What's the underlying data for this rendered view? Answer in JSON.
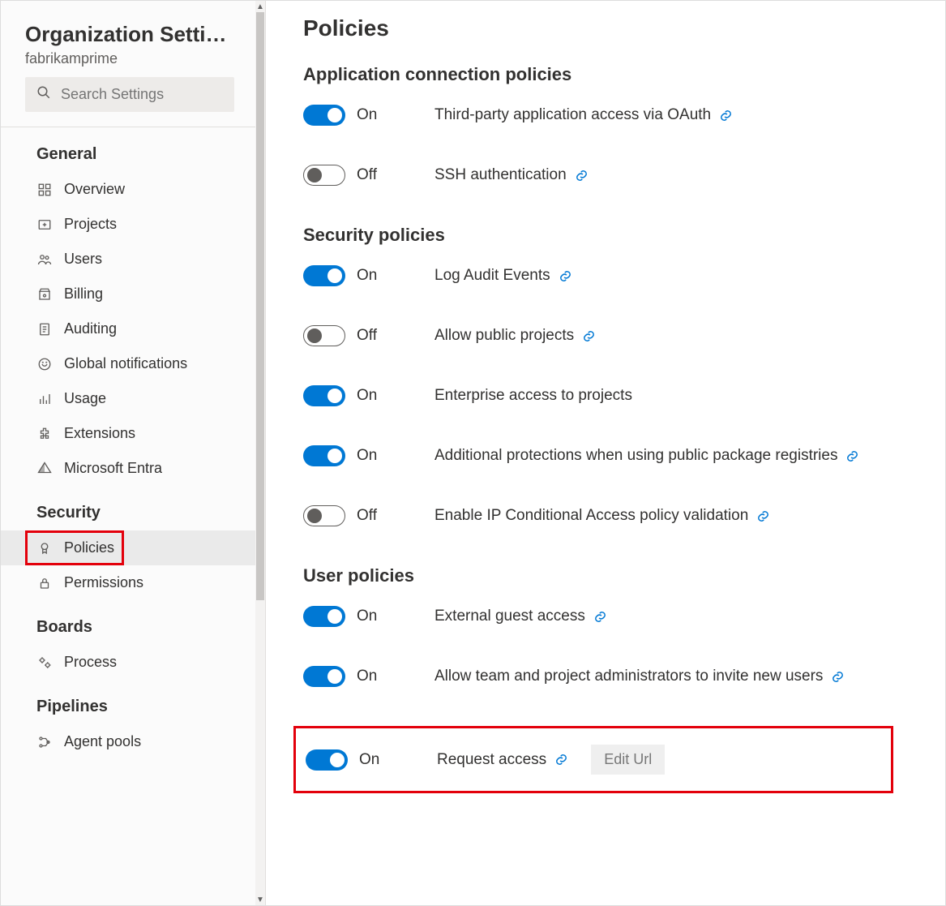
{
  "sidebar": {
    "title": "Organization Settin...",
    "subtitle": "fabrikamprime",
    "search_placeholder": "Search Settings",
    "groups": [
      {
        "title": "General",
        "items": [
          {
            "label": "Overview",
            "icon": "overview-icon"
          },
          {
            "label": "Projects",
            "icon": "projects-icon"
          },
          {
            "label": "Users",
            "icon": "users-icon"
          },
          {
            "label": "Billing",
            "icon": "billing-icon"
          },
          {
            "label": "Auditing",
            "icon": "auditing-icon"
          },
          {
            "label": "Global notifications",
            "icon": "notifications-icon"
          },
          {
            "label": "Usage",
            "icon": "usage-icon"
          },
          {
            "label": "Extensions",
            "icon": "extensions-icon"
          },
          {
            "label": "Microsoft Entra",
            "icon": "entra-icon"
          }
        ]
      },
      {
        "title": "Security",
        "items": [
          {
            "label": "Policies",
            "icon": "policies-icon",
            "selected": true,
            "highlighted": true
          },
          {
            "label": "Permissions",
            "icon": "permissions-icon"
          }
        ]
      },
      {
        "title": "Boards",
        "items": [
          {
            "label": "Process",
            "icon": "process-icon"
          }
        ]
      },
      {
        "title": "Pipelines",
        "items": [
          {
            "label": "Agent pools",
            "icon": "agent-pools-icon"
          }
        ]
      }
    ]
  },
  "main": {
    "page_title": "Policies",
    "on_label": "On",
    "off_label": "Off",
    "edit_url_label": "Edit Url",
    "sections": [
      {
        "title": "Application connection policies",
        "policies": [
          {
            "on": true,
            "label": "Third-party application access via OAuth",
            "link": true
          },
          {
            "on": false,
            "label": "SSH authentication",
            "link": true
          }
        ]
      },
      {
        "title": "Security policies",
        "policies": [
          {
            "on": true,
            "label": "Log Audit Events",
            "link": true
          },
          {
            "on": false,
            "label": "Allow public projects",
            "link": true
          },
          {
            "on": true,
            "label": "Enterprise access to projects",
            "link": false
          },
          {
            "on": true,
            "label": "Additional protections when using public package registries",
            "link": true
          },
          {
            "on": false,
            "label": "Enable IP Conditional Access policy validation",
            "link": true
          }
        ]
      },
      {
        "title": "User policies",
        "policies": [
          {
            "on": true,
            "label": "External guest access",
            "link": true
          },
          {
            "on": true,
            "label": "Allow team and project administrators to invite new users",
            "link": true
          },
          {
            "on": true,
            "label": "Request access",
            "link": true,
            "edit_url": true,
            "highlighted": true
          }
        ]
      }
    ]
  }
}
